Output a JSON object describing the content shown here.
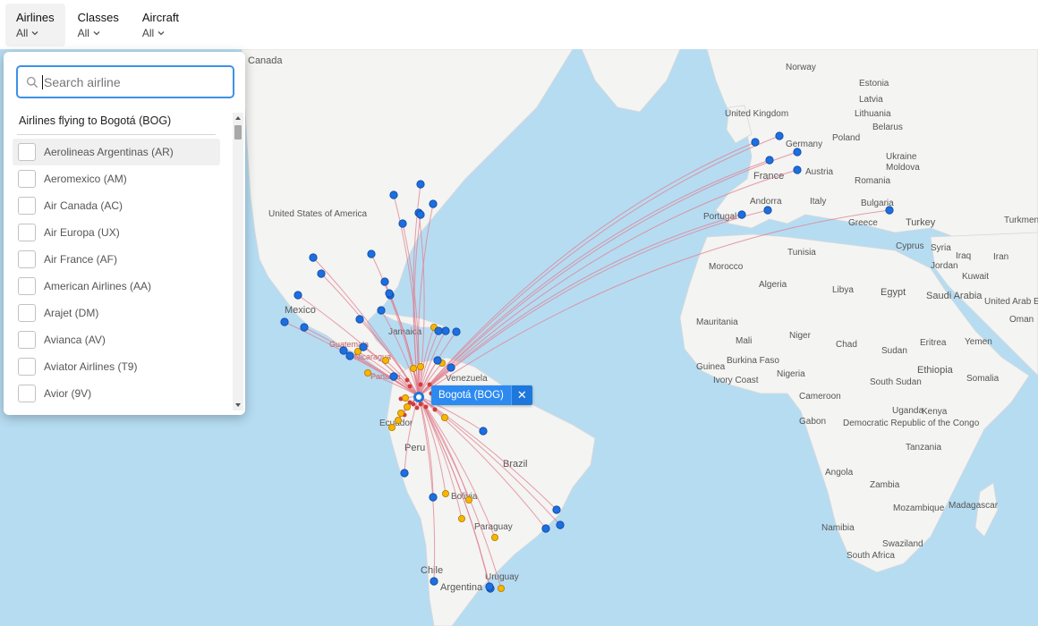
{
  "filters": [
    {
      "title": "Airlines",
      "value": "All",
      "active": true
    },
    {
      "title": "Classes",
      "value": "All",
      "active": false
    },
    {
      "title": "Aircraft",
      "value": "All",
      "active": false
    }
  ],
  "panel": {
    "search_placeholder": "Search airline",
    "list_header": "Airlines flying to Bogotá (BOG)",
    "airlines": [
      "Aerolineas Argentinas (AR)",
      "Aeromexico (AM)",
      "Air Canada (AC)",
      "Air Europa (UX)",
      "Air France (AF)",
      "American Airlines (AA)",
      "Arajet (DM)",
      "Avianca (AV)",
      "Aviator Airlines (T9)",
      "Avior (9V)"
    ]
  },
  "origin": {
    "label": "Bogotá (BOG)",
    "close_icon": "close-icon"
  },
  "map_labels": [
    "Canada",
    "United States of America",
    "Mexico",
    "Guatemala",
    "Nicaragua",
    "Panama",
    "Jamaica",
    "Venezuela",
    "Ecuador",
    "Peru",
    "Brazil",
    "Bolivia",
    "Paraguay",
    "Chile",
    "Argentina",
    "Uruguay",
    "Norway",
    "Estonia",
    "Latvia",
    "Lithuania",
    "Belarus",
    "Poland",
    "Ukraine",
    "Germany",
    "United Kingdom",
    "France",
    "Austria",
    "Romania",
    "Moldova",
    "Bulgaria",
    "Turkey",
    "Italy",
    "Andorra",
    "Portugal",
    "Greece",
    "Morocco",
    "Tunisia",
    "Algeria",
    "Libya",
    "Egypt",
    "Cyprus",
    "Syria",
    "Iraq",
    "Iran",
    "Kuwait",
    "Jordan",
    "Saudi Arabia",
    "United Arab Emirates",
    "Oman",
    "Yemen",
    "Turkmen",
    "Mauritania",
    "Mali",
    "Niger",
    "Chad",
    "Sudan",
    "Eritrea",
    "Ethiopia",
    "Somalia",
    "Burkina Faso",
    "Guinea",
    "Ivory Coast",
    "Nigeria",
    "Cameroon",
    "Gabon",
    "Democratic Republic of the Congo",
    "South Sudan",
    "Uganda",
    "Kenya",
    "Tanzania",
    "Angola",
    "Zambia",
    "Namibia",
    "Mozambique",
    "Madagascar",
    "Swaziland",
    "South Africa"
  ],
  "colors": {
    "route": "#e07f8f",
    "airport_direct": "#1d6fe0",
    "airport_connecting": "#f7b500",
    "airport_domestic": "#d23c3c",
    "ocean": "#b6dcf2",
    "land": "#f4f4f2"
  }
}
